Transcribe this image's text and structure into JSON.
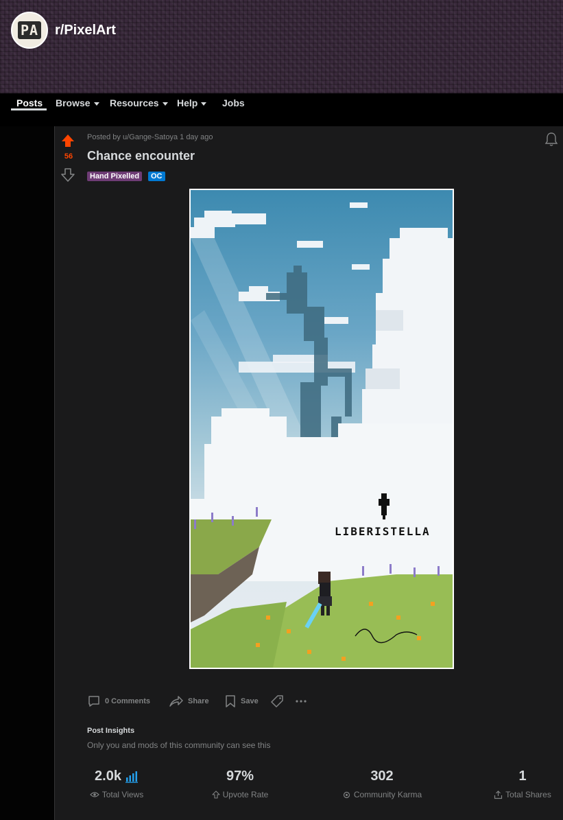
{
  "subreddit": {
    "avatar_text": "PA",
    "name": "r/PixelArt"
  },
  "nav": {
    "items": [
      {
        "label": "Posts"
      },
      {
        "label": "Browse"
      },
      {
        "label": "Resources"
      },
      {
        "label": "Help"
      },
      {
        "label": "Jobs"
      }
    ]
  },
  "post": {
    "score": "56",
    "meta": "Posted by u/Gange-Satoya 1 day ago",
    "title": "Chance encounter",
    "flairs": [
      "Hand Pixelled",
      "OC"
    ],
    "image": {
      "logo_text": "LIBERISTELLA"
    },
    "actions": {
      "comments": "0 Comments",
      "share": "Share",
      "save": "Save"
    }
  },
  "insights": {
    "title": "Post Insights",
    "subtitle": "Only you and mods of this community can see this",
    "stats": [
      {
        "value": "2.0k",
        "label": "Total Views"
      },
      {
        "value": "97%",
        "label": "Upvote Rate"
      },
      {
        "value": "302",
        "label": "Community Karma"
      },
      {
        "value": "1",
        "label": "Total Shares"
      }
    ]
  },
  "colors": {
    "upvote": "#ff4500",
    "flair_hand_pixelled": "#6e3c75",
    "flair_oc": "#0079d3",
    "views_chart_icon": "#24a0ed"
  }
}
